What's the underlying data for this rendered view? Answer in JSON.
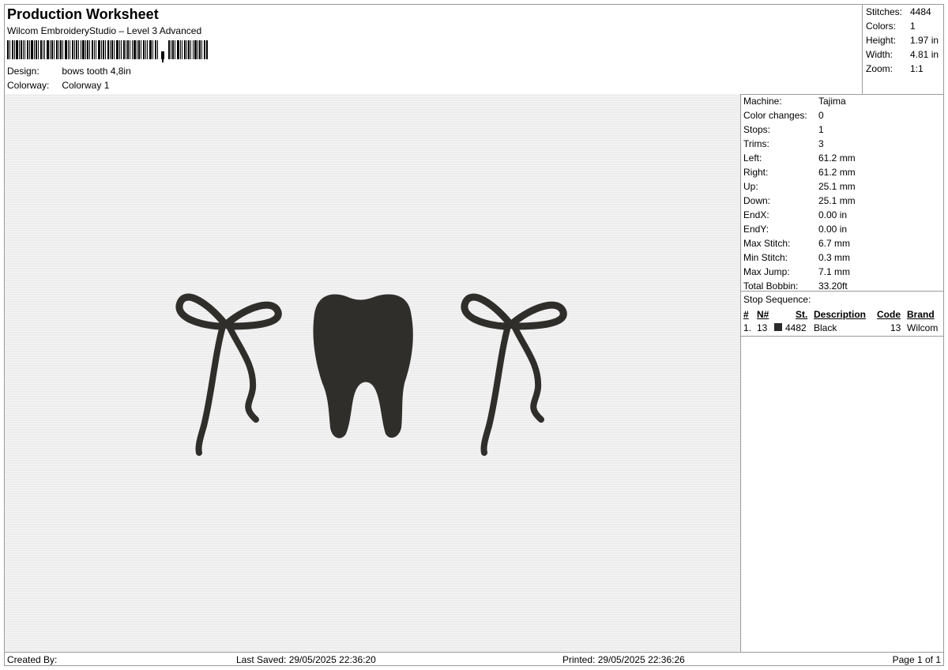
{
  "header": {
    "title": "Production Worksheet",
    "software": "Wilcom EmbroideryStudio – Level 3 Advanced",
    "design_label": "Design:",
    "design_value": "bows tooth 4,8in",
    "colorway_label": "Colorway:",
    "colorway_value": "Colorway 1"
  },
  "top_stats": [
    {
      "label": "Stitches:",
      "value": "4484"
    },
    {
      "label": "Colors:",
      "value": "1"
    },
    {
      "label": "Height:",
      "value": "1.97 in"
    },
    {
      "label": "Width:",
      "value": "4.81 in"
    },
    {
      "label": "Zoom:",
      "value": "1:1"
    }
  ],
  "machine_info": [
    {
      "label": "Machine:",
      "value": "Tajima"
    },
    {
      "label": "Color changes:",
      "value": "0"
    },
    {
      "label": "Stops:",
      "value": "1"
    },
    {
      "label": "Trims:",
      "value": "3"
    },
    {
      "label": "Left:",
      "value": "61.2 mm"
    },
    {
      "label": "Right:",
      "value": "61.2 mm"
    },
    {
      "label": "Up:",
      "value": "25.1 mm"
    },
    {
      "label": "Down:",
      "value": "25.1 mm"
    },
    {
      "label": "EndX:",
      "value": "0.00 in"
    },
    {
      "label": "EndY:",
      "value": "0.00 in"
    },
    {
      "label": "Max Stitch:",
      "value": "6.7 mm"
    },
    {
      "label": "Min Stitch:",
      "value": "0.3 mm"
    },
    {
      "label": "Max Jump:",
      "value": "7.1 mm"
    },
    {
      "label": "Total Bobbin:",
      "value": "33.20ft"
    }
  ],
  "stop_sequence": {
    "title": "Stop Sequence:",
    "headers": {
      "num": "#",
      "n": "N#",
      "st": "St.",
      "description": "Description",
      "code": "Code",
      "brand": "Brand"
    },
    "rows": [
      {
        "num": "1.",
        "n": "13",
        "st": "4482",
        "description": "Black",
        "code": "13",
        "brand": "Wilcom",
        "color": "#2a2a2a"
      }
    ]
  },
  "footer": {
    "created_by": "Created By:",
    "last_saved": "Last Saved: 29/05/2025 22:36:20",
    "printed": "Printed: 29/05/2025 22:36:26",
    "page": "Page 1 of 1"
  },
  "colors": {
    "thread": "#2f2e2b",
    "fabric": "#ececec",
    "border": "#9a9a9a"
  }
}
